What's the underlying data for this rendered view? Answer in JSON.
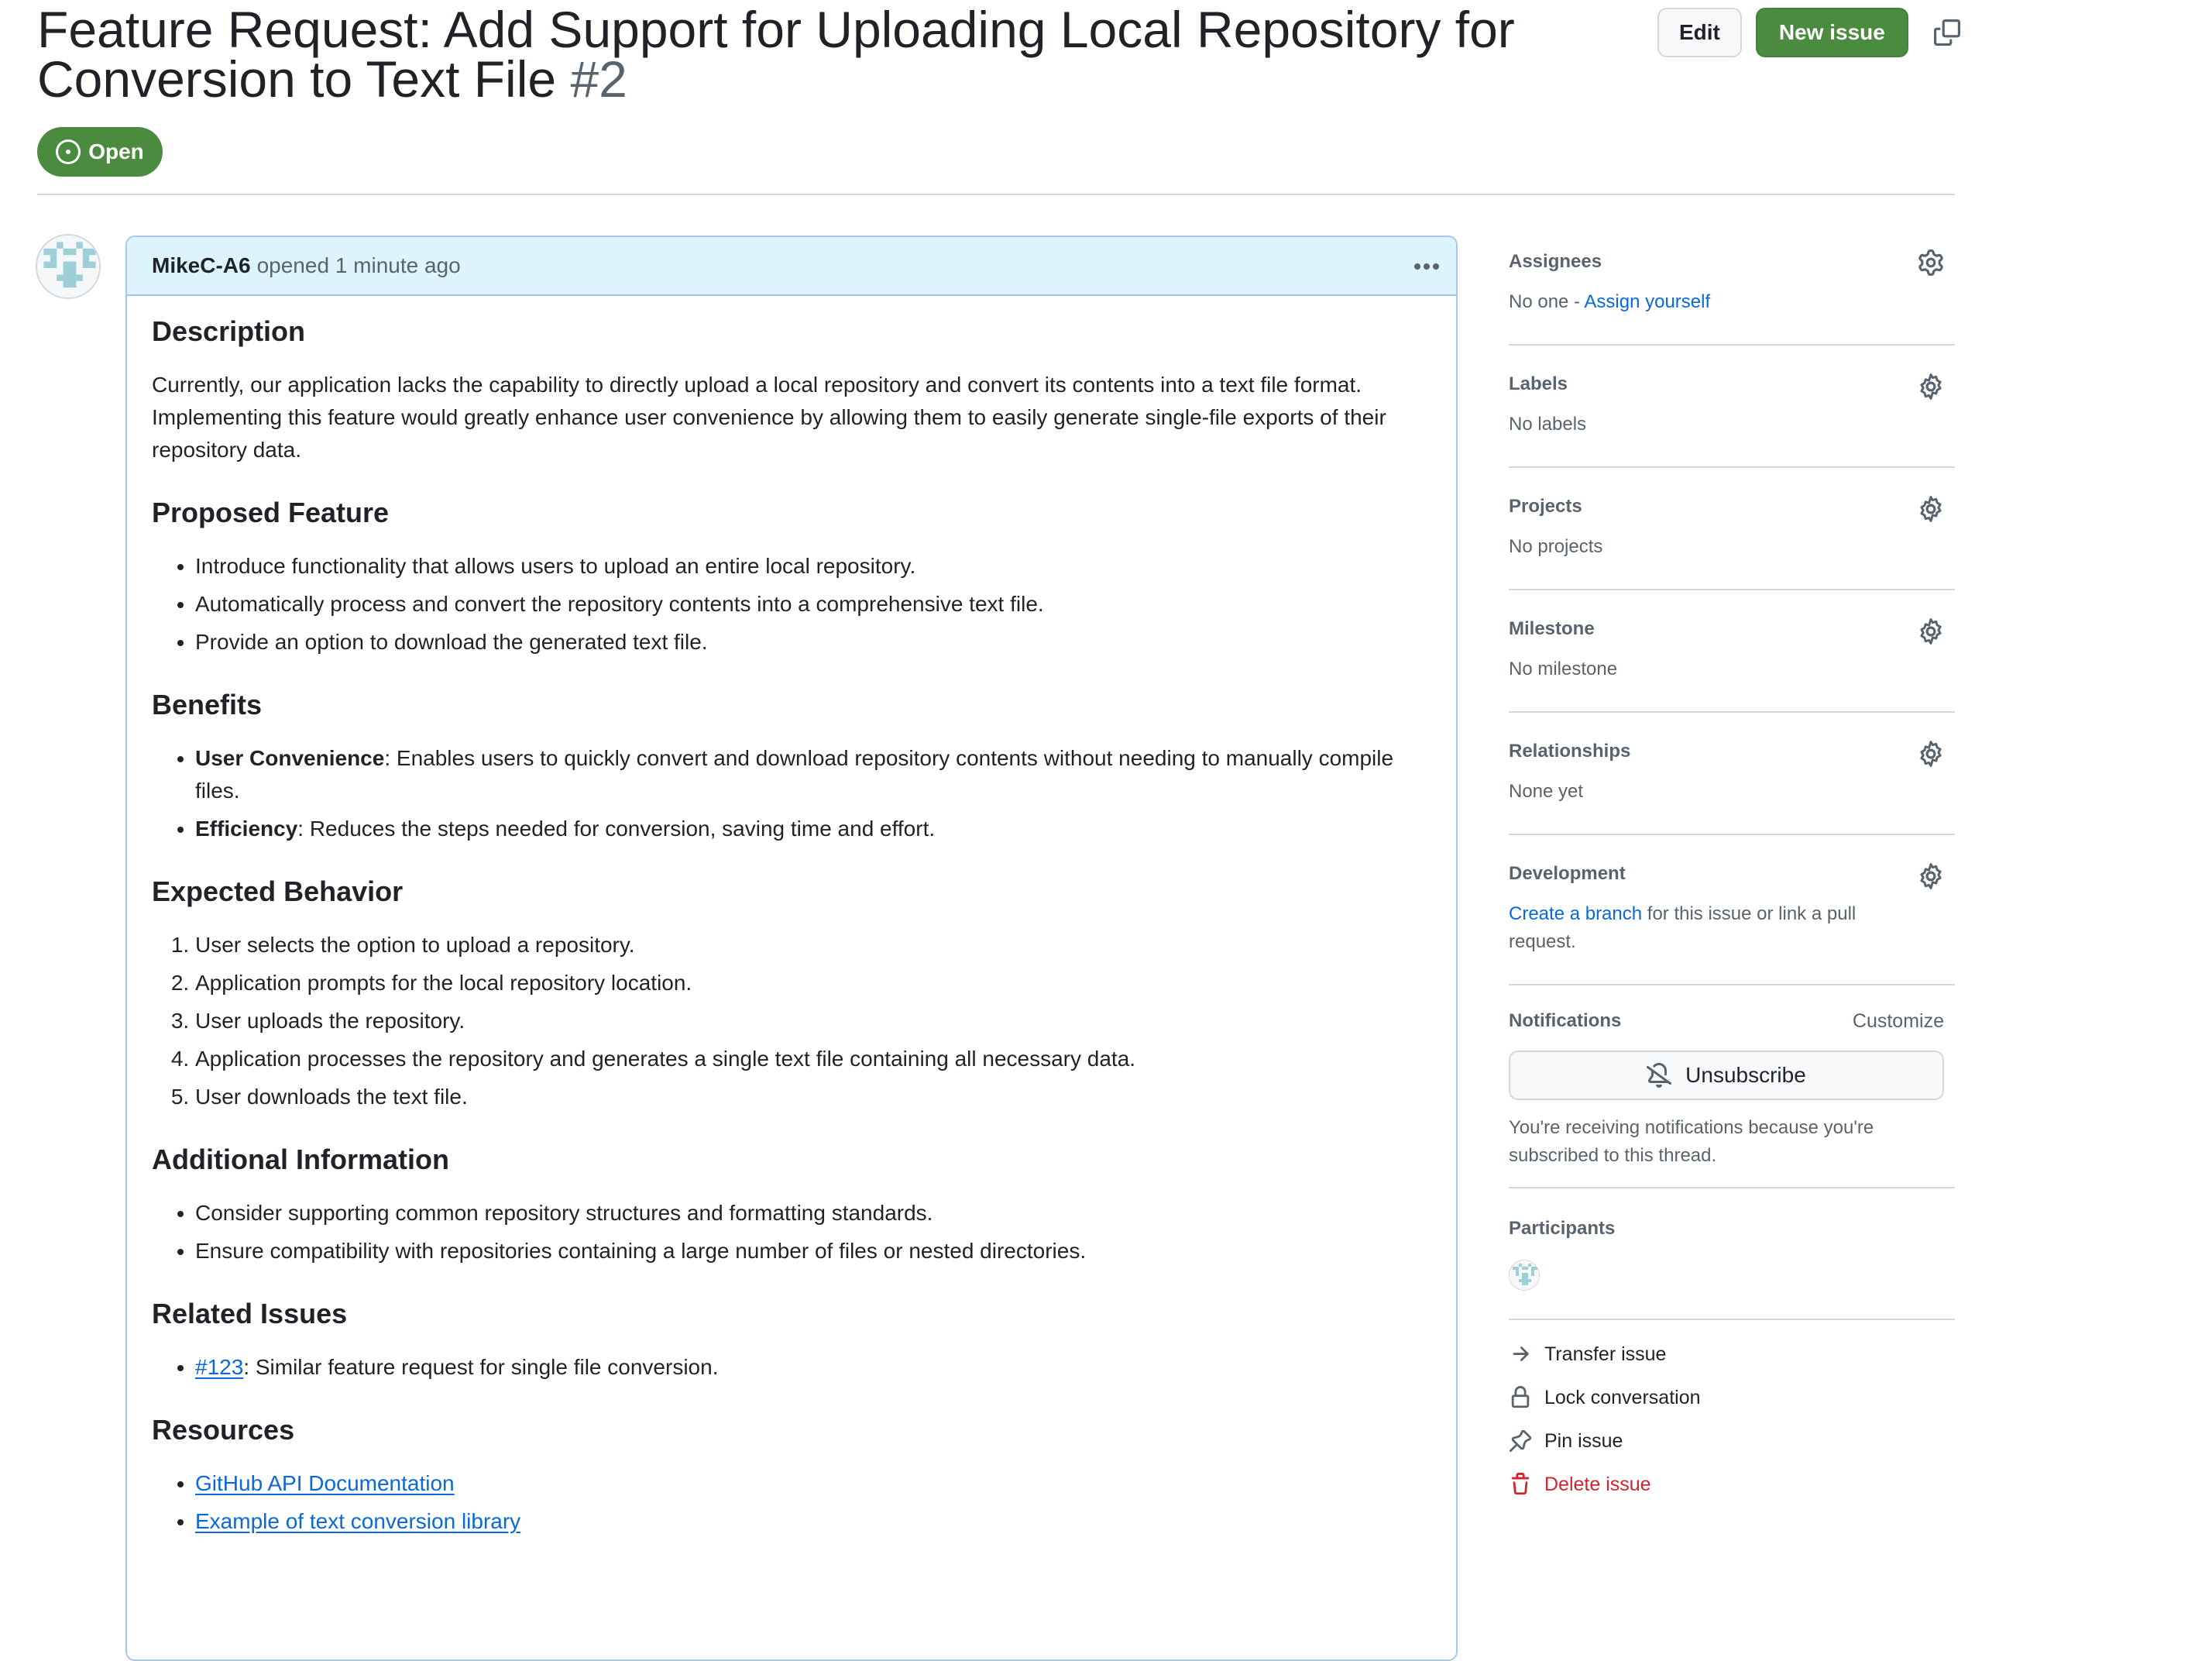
{
  "issue": {
    "title": "Feature Request: Add Support for Uploading Local Repository for Conversion to Text File",
    "number": "#2",
    "state": "Open"
  },
  "header_actions": {
    "edit_label": "Edit",
    "new_issue_label": "New issue",
    "copy_icon": "copy-icon"
  },
  "comment": {
    "author": "MikeC-A6",
    "meta": "opened 1 minute ago",
    "sections": {
      "description": {
        "heading": "Description",
        "text": "Currently, our application lacks the capability to directly upload a local repository and convert its contents into a text file format. Implementing this feature would greatly enhance user convenience by allowing them to easily generate single-file exports of their repository data."
      },
      "proposed": {
        "heading": "Proposed Feature",
        "items": [
          "Introduce functionality that allows users to upload an entire local repository.",
          "Automatically process and convert the repository contents into a comprehensive text file.",
          "Provide an option to download the generated text file."
        ]
      },
      "benefits": {
        "heading": "Benefits",
        "items": [
          {
            "bold": "User Convenience",
            "text": ": Enables users to quickly convert and download repository contents without needing to manually compile files."
          },
          {
            "bold": "Efficiency",
            "text": ": Reduces the steps needed for conversion, saving time and effort."
          }
        ]
      },
      "expected": {
        "heading": "Expected Behavior",
        "items": [
          "User selects the option to upload a repository.",
          "Application prompts for the local repository location.",
          "User uploads the repository.",
          "Application processes the repository and generates a single text file containing all necessary data.",
          "User downloads the text file."
        ]
      },
      "additional": {
        "heading": "Additional Information",
        "items": [
          "Consider supporting common repository structures and formatting standards.",
          "Ensure compatibility with repositories containing a large number of files or nested directories."
        ]
      },
      "related": {
        "heading": "Related Issues",
        "link": "#123",
        "text": ": Similar feature request for single file conversion."
      },
      "resources": {
        "heading": "Resources",
        "links": [
          "GitHub API Documentation",
          "Example of text conversion library"
        ]
      }
    }
  },
  "sidebar": {
    "assignees": {
      "heading": "Assignees",
      "value_prefix": "No one - ",
      "link": "Assign yourself"
    },
    "labels": {
      "heading": "Labels",
      "value": "No labels"
    },
    "projects": {
      "heading": "Projects",
      "value": "No projects"
    },
    "milestone": {
      "heading": "Milestone",
      "value": "No milestone"
    },
    "relationships": {
      "heading": "Relationships",
      "value": "None yet"
    },
    "development": {
      "heading": "Development",
      "link": "Create a branch",
      "text": " for this issue or link a pull request."
    },
    "notifications": {
      "heading": "Notifications",
      "customize": "Customize",
      "button": "Unsubscribe",
      "note": "You're receiving notifications because you're subscribed to this thread."
    },
    "participants": {
      "heading": "Participants"
    },
    "actions": {
      "transfer": "Transfer issue",
      "lock": "Lock conversation",
      "pin": "Pin issue",
      "delete": "Delete issue"
    }
  },
  "colors": {
    "open_green": "#4b8b3f",
    "link_blue": "#0969da",
    "danger_red": "#d1242f",
    "comment_header_bg": "#ddf4ff",
    "avatar_teal": "#9ccfd8"
  }
}
